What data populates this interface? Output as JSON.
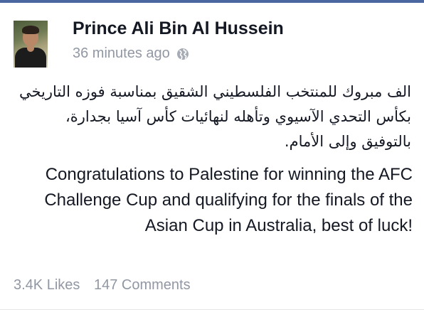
{
  "post": {
    "author_name": "Prince Ali Bin Al Hussein",
    "timestamp": "36 minutes ago",
    "privacy_icon": "globe-icon",
    "body_arabic": "الف مبروك للمنتخب الفلسطيني الشقيق بمناسبة فوزه التاريخي بكأس التحدي الآسيوي وتأهله لنهائيات كأس آسيا بجدارة، بالتوفيق وإلى الأمام.",
    "body_english": "Congratulations to Palestine for winning the AFC Challenge Cup and qualifying for the finals of the Asian Cup in Australia, best of luck!"
  },
  "stats": {
    "likes": "3.4K Likes",
    "comments": "147 Comments"
  },
  "colors": {
    "brand_blue": "#4b67a1",
    "text": "#141823",
    "muted": "#9197a3"
  }
}
